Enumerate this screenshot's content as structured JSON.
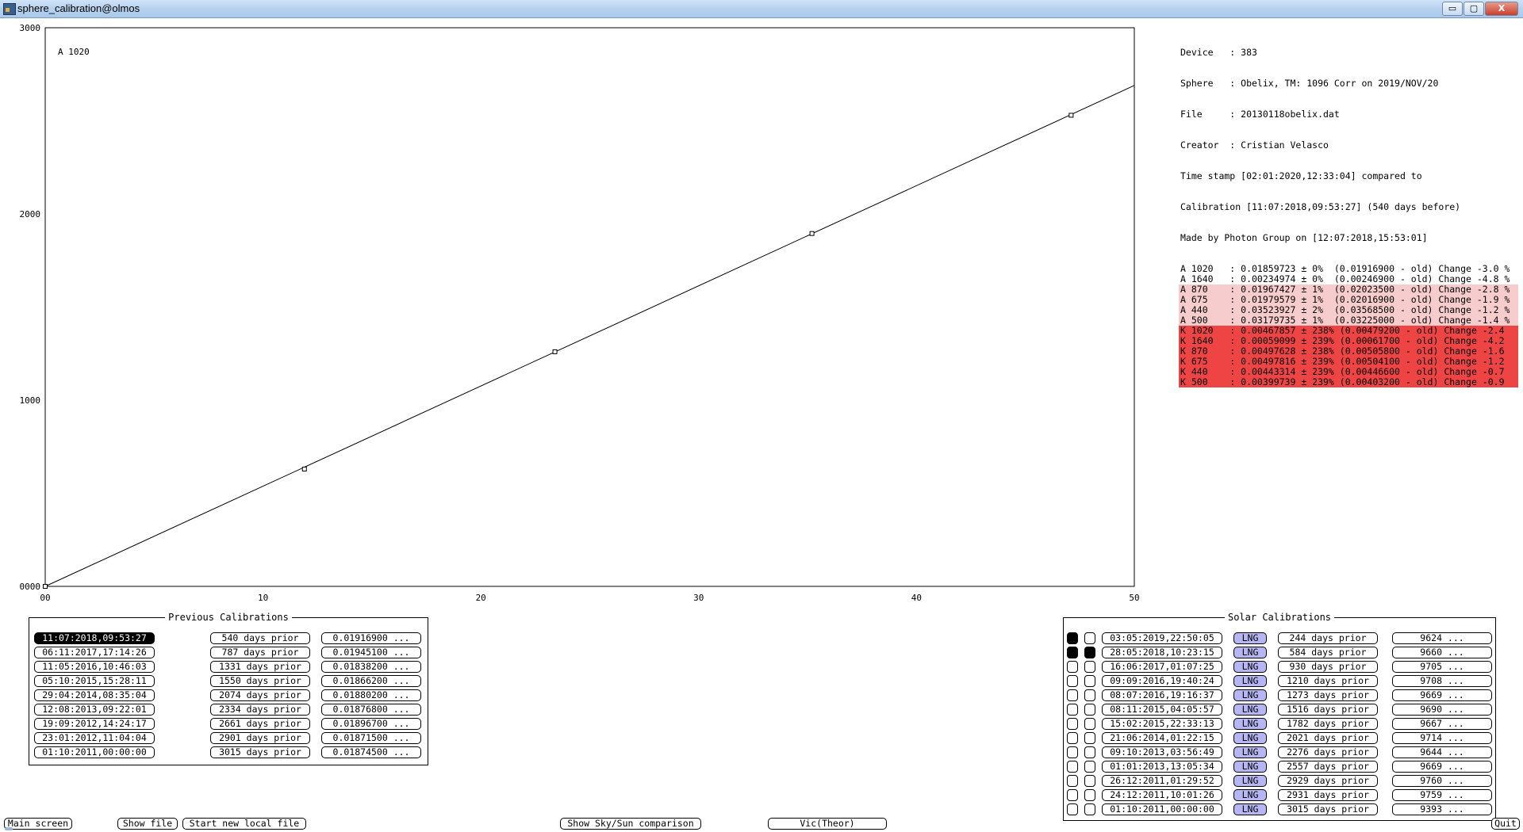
{
  "window": {
    "title": "sphere_calibration@olmos",
    "buttons": [
      "▭",
      "▢",
      "X"
    ]
  },
  "chart_data": {
    "type": "line",
    "label": "A 1020",
    "xlim": [
      0,
      50
    ],
    "ylim": [
      0,
      3000
    ],
    "x_ticks": [
      "00",
      "10",
      "20",
      "30",
      "40",
      "50"
    ],
    "y_ticks": [
      "0000",
      "1000",
      "2000",
      "3000"
    ],
    "points": [
      {
        "x": 0,
        "y": 0
      },
      {
        "x": 11.9,
        "y": 630
      },
      {
        "x": 23.4,
        "y": 1260
      },
      {
        "x": 35.2,
        "y": 1895
      },
      {
        "x": 47.1,
        "y": 2530
      }
    ],
    "fit_line": {
      "x": [
        0,
        50
      ],
      "y": [
        0,
        2690
      ]
    }
  },
  "info": {
    "device": "Device   : 383",
    "sphere": "Sphere   : Obelix, TM: 1096 Corr on 2019/NOV/20",
    "file": "File     : 20130118obelix.dat",
    "creator": "Creator  : Cristian Velasco",
    "timestamp": "Time stamp [02:01:2020,12:33:04] compared to",
    "calibration": "Calibration [11:07:2018,09:53:27] (540 days before)",
    "made_by": "Made by Photon Group on [12:07:2018,15:53:01]",
    "rows": [
      {
        "text": "A 1020   : 0.01859723 ± 0%  (0.01916900 - old) Change -3.0 %",
        "color": "none"
      },
      {
        "text": "A 1640   : 0.00234974 ± 0%  (0.00246900 - old) Change -4.8 %",
        "color": "none"
      },
      {
        "text": "A 870    : 0.01967427 ± 1%  (0.02023500 - old) Change -2.8 %",
        "color": "pink"
      },
      {
        "text": "A 675    : 0.01979579 ± 1%  (0.02016900 - old) Change -1.9 %",
        "color": "pink"
      },
      {
        "text": "A 440    : 0.03523927 ± 2%  (0.03568500 - old) Change -1.2 %",
        "color": "pink"
      },
      {
        "text": "A 500    : 0.03179735 ± 1%  (0.03225000 - old) Change -1.4 %",
        "color": "pink"
      },
      {
        "text": "K 1020   : 0.00467857 ± 238% (0.00479200 - old) Change -2.4",
        "color": "red"
      },
      {
        "text": "K 1640   : 0.00059099 ± 239% (0.00061700 - old) Change -4.2",
        "color": "red"
      },
      {
        "text": "K 870    : 0.00497628 ± 238% (0.00505800 - old) Change -1.6",
        "color": "red"
      },
      {
        "text": "K 675    : 0.00497816 ± 239% (0.00504100 - old) Change -1.2",
        "color": "red"
      },
      {
        "text": "K 440    : 0.00443314 ± 239% (0.00446600 - old) Change -0.7",
        "color": "red"
      },
      {
        "text": "K 500    : 0.00399739 ± 239% (0.00403200 - old) Change -0.9",
        "color": "red"
      }
    ]
  },
  "previous_calibrations": {
    "title": "Previous Calibrations",
    "rows": [
      {
        "date": "11:07:2018,09:53:27",
        "days": "540 days prior",
        "value": "0.01916900 ...",
        "selected": true
      },
      {
        "date": "06:11:2017,17:14:26",
        "days": "787 days prior",
        "value": "0.01945100 ...",
        "selected": false
      },
      {
        "date": "11:05:2016,10:46:03",
        "days": "1331 days prior",
        "value": "0.01838200 ...",
        "selected": false
      },
      {
        "date": "05:10:2015,15:28:11",
        "days": "1550 days prior",
        "value": "0.01866200 ...",
        "selected": false
      },
      {
        "date": "29:04:2014,08:35:04",
        "days": "2074 days prior",
        "value": "0.01880200 ...",
        "selected": false
      },
      {
        "date": "12:08:2013,09:22:01",
        "days": "2334 days prior",
        "value": "0.01876800 ...",
        "selected": false
      },
      {
        "date": "19:09:2012,14:24:17",
        "days": "2661 days prior",
        "value": "0.01896700 ...",
        "selected": false
      },
      {
        "date": "23:01:2012,11:04:04",
        "days": "2901 days prior",
        "value": "0.01871500 ...",
        "selected": false
      },
      {
        "date": "01:10:2011,00:00:00",
        "days": "3015 days prior",
        "value": "0.01874500 ...",
        "selected": false
      }
    ]
  },
  "solar_calibrations": {
    "title": "Solar Calibrations",
    "rows": [
      {
        "r1": true,
        "r2": false,
        "date": "03:05:2019,22:50:05",
        "tag": "LNG",
        "days": "244 days prior",
        "value": "9624 ..."
      },
      {
        "r1": true,
        "r2": true,
        "date": "28:05:2018,10:23:15",
        "tag": "LNG",
        "days": "584 days prior",
        "value": "9660 ..."
      },
      {
        "r1": false,
        "r2": false,
        "date": "16:06:2017,01:07:25",
        "tag": "LNG",
        "days": "930 days prior",
        "value": "9705 ..."
      },
      {
        "r1": false,
        "r2": false,
        "date": "09:09:2016,19:40:24",
        "tag": "LNG",
        "days": "1210 days prior",
        "value": "9708 ..."
      },
      {
        "r1": false,
        "r2": false,
        "date": "08:07:2016,19:16:37",
        "tag": "LNG",
        "days": "1273 days prior",
        "value": "9669 ..."
      },
      {
        "r1": false,
        "r2": false,
        "date": "08:11:2015,04:05:57",
        "tag": "LNG",
        "days": "1516 days prior",
        "value": "9690 ..."
      },
      {
        "r1": false,
        "r2": false,
        "date": "15:02:2015,22:33:13",
        "tag": "LNG",
        "days": "1782 days prior",
        "value": "9667 ..."
      },
      {
        "r1": false,
        "r2": false,
        "date": "21:06:2014,01:22:15",
        "tag": "LNG",
        "days": "2021 days prior",
        "value": "9714 ..."
      },
      {
        "r1": false,
        "r2": false,
        "date": "09:10:2013,03:56:49",
        "tag": "LNG",
        "days": "2276 days prior",
        "value": "9644 ..."
      },
      {
        "r1": false,
        "r2": false,
        "date": "01:01:2013,13:05:34",
        "tag": "LNG",
        "days": "2557 days prior",
        "value": "9669 ..."
      },
      {
        "r1": false,
        "r2": false,
        "date": "26:12:2011,01:29:52",
        "tag": "LNG",
        "days": "2929 days prior",
        "value": "9760 ..."
      },
      {
        "r1": false,
        "r2": false,
        "date": "24:12:2011,10:01:26",
        "tag": "LNG",
        "days": "2931 days prior",
        "value": "9759 ..."
      },
      {
        "r1": false,
        "r2": false,
        "date": "01:10:2011,00:00:00",
        "tag": "LNG",
        "days": "3015 days prior",
        "value": "9393 ..."
      }
    ]
  },
  "bottom_bar": {
    "main_screen": "Main screen",
    "show_file": "Show file",
    "start_new": "Start new local file",
    "show_sky": "Show Sky/Sun comparison",
    "vic": "Vic(Theor)",
    "quit": "Quit"
  },
  "colors": {
    "pink_row": "#f6cccc",
    "red_row": "#ee4444",
    "lng_tag": "#b6b6f4"
  }
}
